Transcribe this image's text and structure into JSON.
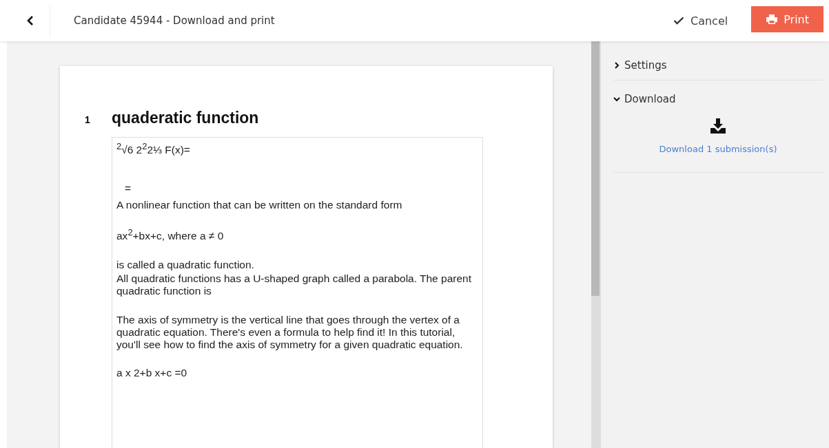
{
  "header": {
    "title": "Candidate 45944 - Download and print",
    "cancel": "Cancel",
    "print": "Print"
  },
  "question": {
    "number": "1",
    "title": "quaderatic function",
    "answer_blocks": [
      [
        "$^{2}$√6 2$^{2}$2⅓   F(x)="
      ],
      [
        "="
      ],
      [
        "A nonlinear function that can be written on the standard form"
      ],
      [
        "ax$^{2}$+bx+c, where a ≠ 0"
      ],
      [
        "is called a quadratic function.",
        "All quadratic functions has a U-shaped graph called a parabola. The parent quadratic function is"
      ],
      [
        "The axis of symmetry is the vertical line that goes through the vertex of a quadratic equation. There's even a formula to help find it! In this tutorial, you'll see how to find the axis of symmetry for a given quadratic equation."
      ],
      [
        "a x 2+b x+c =0"
      ]
    ]
  },
  "panel": {
    "sections": [
      {
        "label": "Settings",
        "expanded": false
      },
      {
        "label": "Download",
        "expanded": true,
        "link": "Download 1 submission(s)"
      }
    ]
  }
}
